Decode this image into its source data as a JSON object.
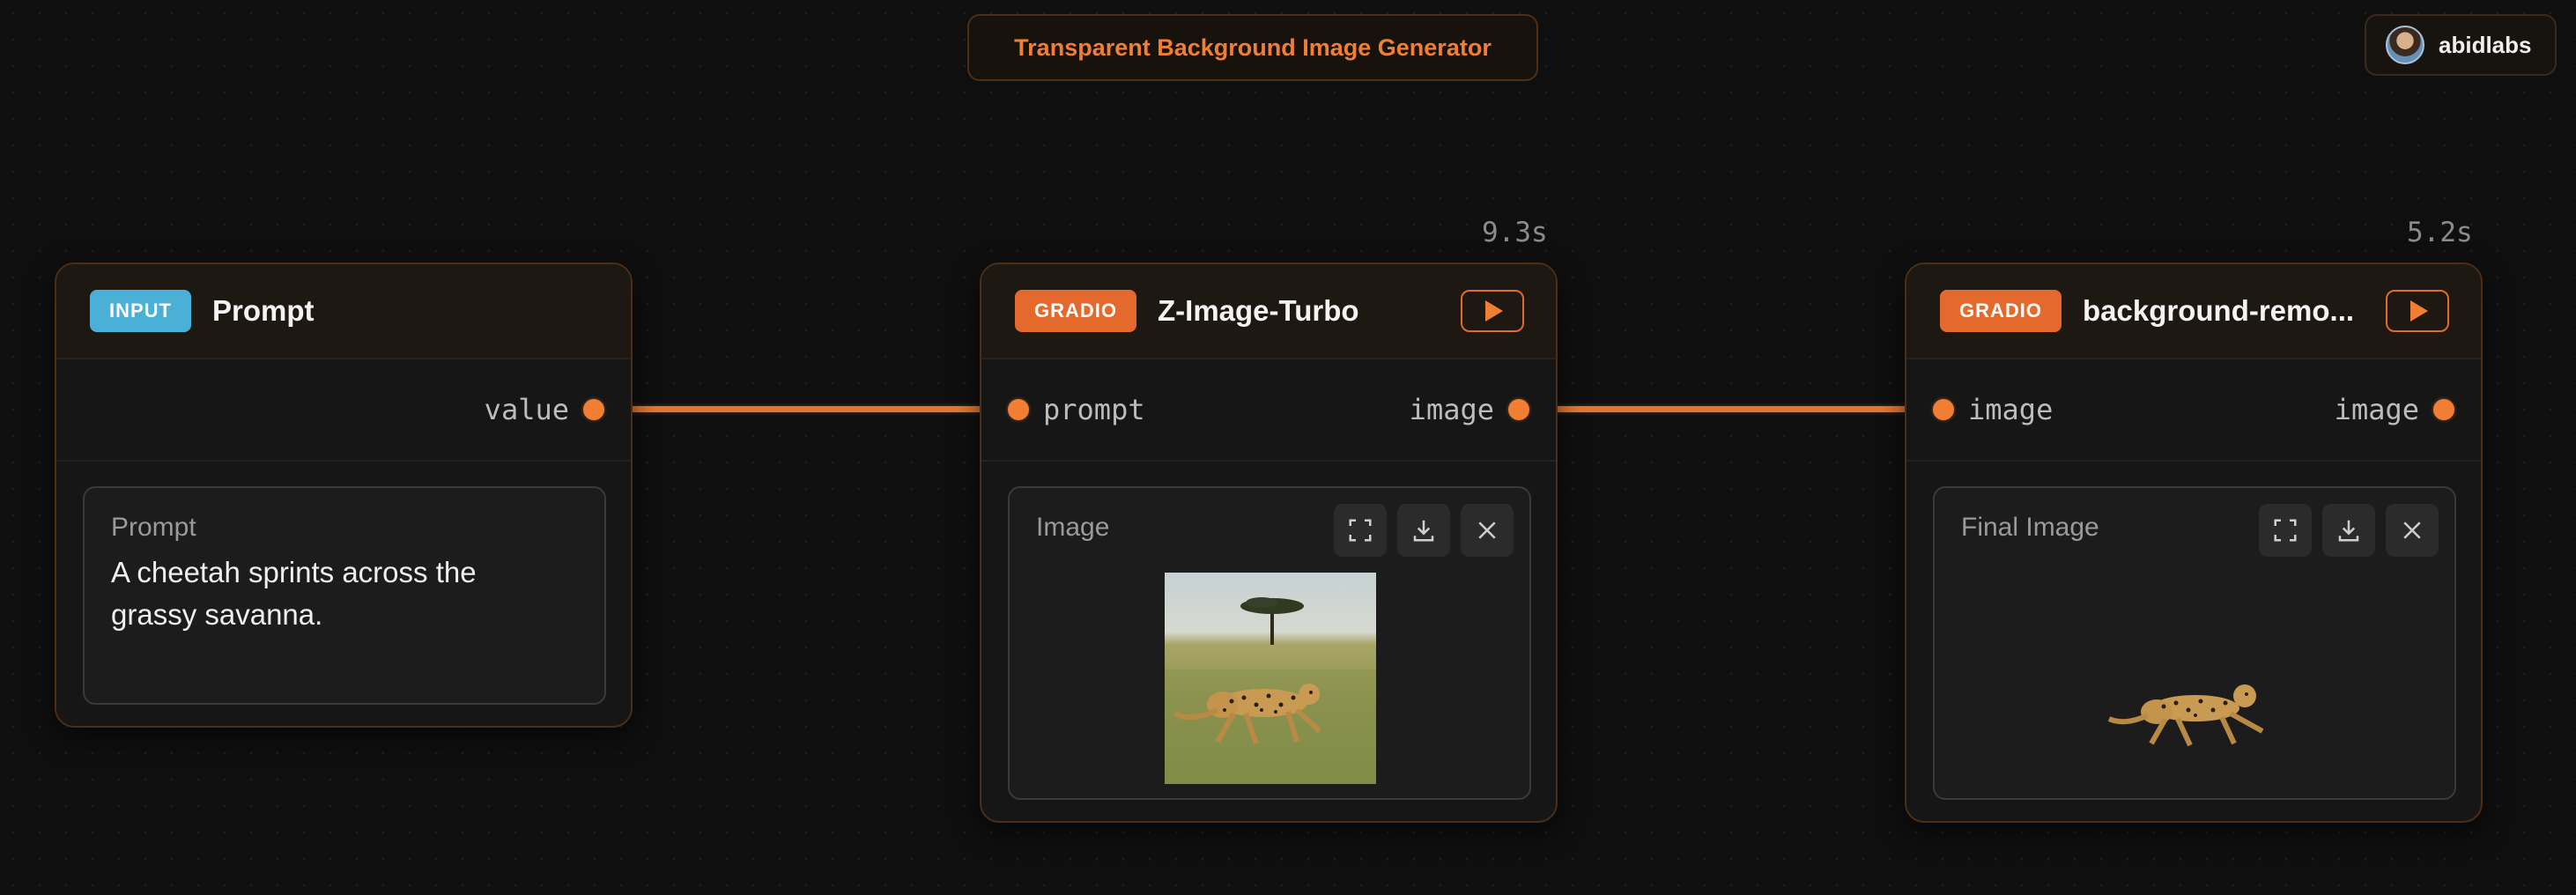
{
  "app": {
    "title": "Transparent Background Image Generator"
  },
  "user": {
    "name": "abidlabs"
  },
  "nodes": {
    "input": {
      "tag": "INPUT",
      "title": "Prompt",
      "output_port": "value",
      "field_label": "Prompt",
      "field_value": "A cheetah sprints across the grassy savanna."
    },
    "z_image": {
      "tag": "GRADIO",
      "title": "Z-Image-Turbo",
      "timing": "9.3s",
      "input_port": "prompt",
      "output_port": "image",
      "panel_label": "Image"
    },
    "bg_remove": {
      "tag": "GRADIO",
      "title": "background-remo...",
      "timing": "5.2s",
      "input_port": "image",
      "output_port": "image",
      "panel_label": "Final Image"
    }
  },
  "icons": [
    "play-icon",
    "fullscreen-icon",
    "download-icon",
    "close-icon",
    "avatar"
  ],
  "colors": {
    "accent": "#f07f33",
    "input_tag": "#4bb0d6",
    "gradio_tag": "#e36a2c",
    "background": "#0f0f0f"
  }
}
